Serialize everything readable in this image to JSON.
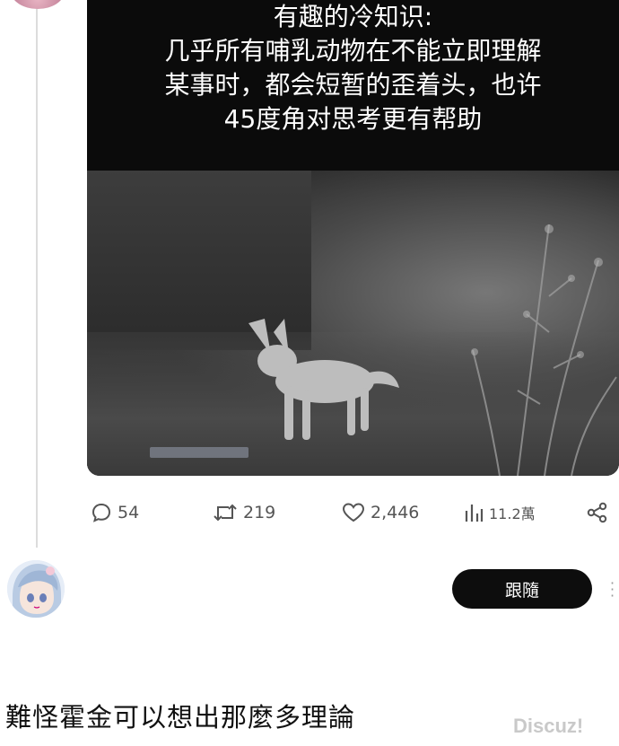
{
  "post": {
    "caption_lines": [
      "有趣的冷知识:",
      "几乎所有哺乳动物在不能立即理解",
      "某事时，都会短暂的歪着头，也许",
      "45度角对思考更有帮助"
    ]
  },
  "actions": {
    "replies": "54",
    "reposts": "219",
    "likes": "2,446",
    "views": "11.2萬"
  },
  "reply": {
    "follow_label": "跟隨",
    "text": "難怪霍金可以想出那麼多理論"
  },
  "watermark": "Discuz!",
  "icons": [
    "reply-bubble-icon",
    "repost-icon",
    "heart-icon",
    "views-bar-icon",
    "share-icon",
    "more-dots-icon"
  ]
}
